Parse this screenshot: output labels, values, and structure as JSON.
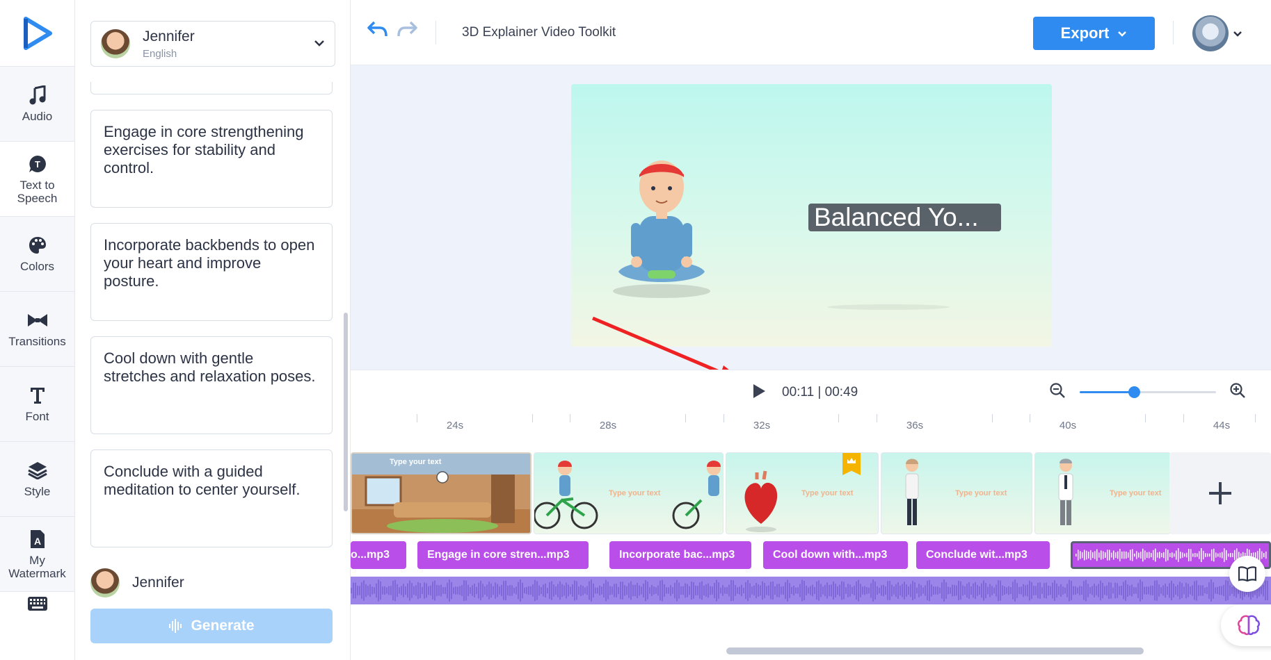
{
  "rail": {
    "items": [
      {
        "label": "Audio",
        "icon": "music-note-icon"
      },
      {
        "label": "Text to Speech",
        "icon": "text-speech-icon"
      },
      {
        "label": "Colors",
        "icon": "palette-icon"
      },
      {
        "label": "Transitions",
        "icon": "bowtie-icon"
      },
      {
        "label": "Font",
        "icon": "font-t-icon"
      },
      {
        "label": "Style",
        "icon": "layers-icon"
      },
      {
        "label": "My Watermark",
        "icon": "watermark-icon"
      }
    ]
  },
  "panel": {
    "voice": {
      "name": "Jennifer",
      "language": "English"
    },
    "texts": [
      "Engage in core strengthening exercises for stability and control.",
      "Incorporate backbends to open your heart and improve posture.",
      "Cool down with gentle stretches and relaxation poses.",
      "Conclude with a guided meditation to center yourself."
    ],
    "voice2_name": "Jennifer",
    "generate_label": "Generate"
  },
  "topbar": {
    "title": "3D Explainer Video Toolkit",
    "export_label": "Export"
  },
  "preview": {
    "title": "Balanced Yo..."
  },
  "player": {
    "current_time": "00:11",
    "separator": "|",
    "total_time": "00:49",
    "zoom_level": 0.4
  },
  "timeline": {
    "ruler_labels": [
      "24s",
      "28s",
      "32s",
      "36s",
      "40s",
      "44s"
    ],
    "scenes": [
      {
        "text": "Type your text"
      },
      {
        "text": "Type your text"
      },
      {
        "text": "Type your text"
      },
      {
        "text": "Type your text"
      },
      {
        "text": "Type your text"
      }
    ],
    "clips": [
      "o...mp3",
      "Engage in core stren...mp3",
      "Incorporate bac...mp3",
      "Cool down with...mp3",
      "Conclude wit...mp3"
    ]
  },
  "colors": {
    "accent": "#2f8bf0",
    "clip": "#b94ee8",
    "waveform": "#9c85e9",
    "generate_disabled": "#a9d2fb"
  }
}
